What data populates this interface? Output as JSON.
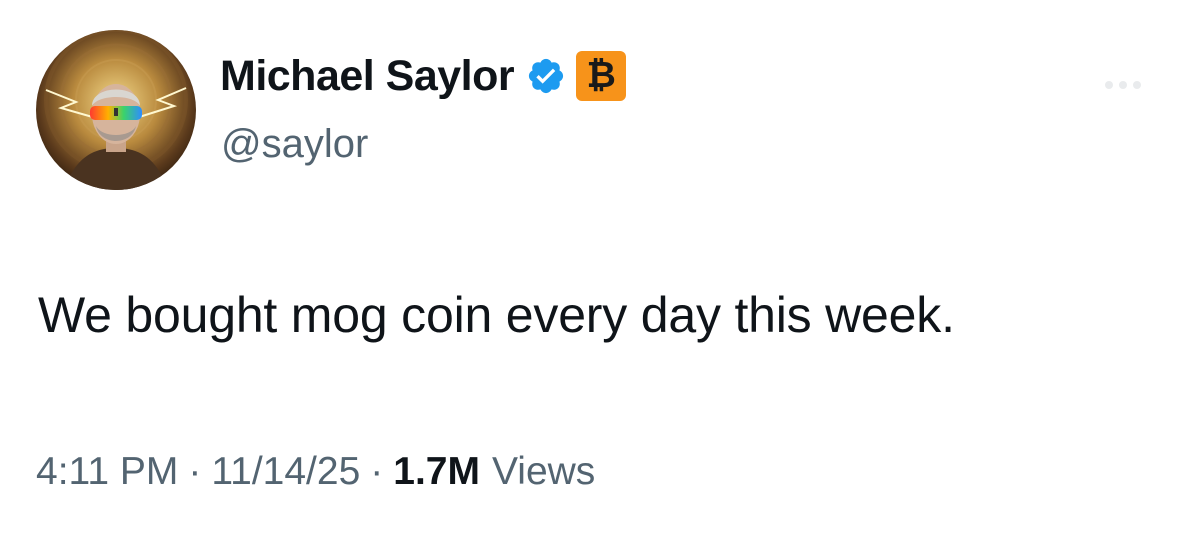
{
  "tweet": {
    "author": {
      "display_name": "Michael Saylor",
      "handle": "@saylor",
      "avatar_icon": "profile-photo",
      "verified_icon": "verified-badge-icon",
      "verified_color": "#1d9bf0",
      "badge": {
        "symbol": "₿",
        "background": "#f7931a",
        "color": "#1a1a1a"
      }
    },
    "text": "We bought mog coin every day this week.",
    "meta": {
      "time": "4:11 PM",
      "separator": "·",
      "date": "11/14/25",
      "views_count": "1.7M",
      "views_label": "Views"
    }
  }
}
